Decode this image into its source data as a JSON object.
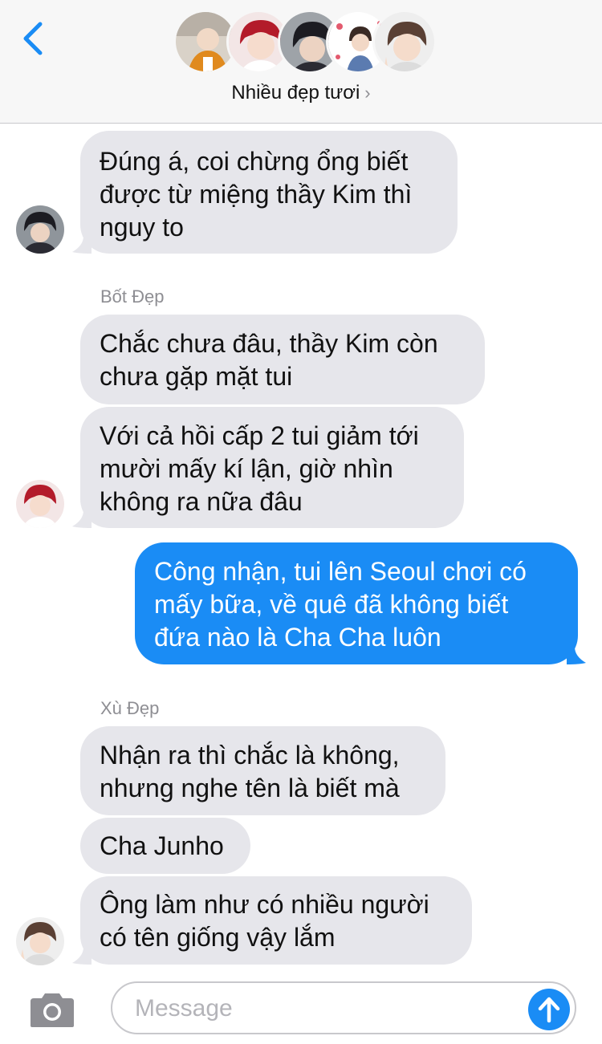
{
  "header": {
    "group_name": "Nhiều đẹp tươi",
    "chevron": "›"
  },
  "icons": {
    "back": "chevron-left-icon",
    "camera": "camera-icon",
    "send": "arrow-up-icon"
  },
  "colors": {
    "accent": "#1a8cf5",
    "incoming_bubble": "#e6e6eb",
    "header_bg": "#f7f7f7"
  },
  "messages": [
    {
      "text": "Đúng á, coi chừng ổng biết\nđược từ miệng thầy Kim thì\nnguy to",
      "direction": "incoming"
    },
    {
      "sender": "Bốt Đẹp"
    },
    {
      "text": "Chắc chưa đâu, thầy Kim còn\nchưa gặp mặt tui",
      "direction": "incoming"
    },
    {
      "text": "Với cả hồi cấp 2 tui giảm tới\nmười mấy kí lận, giờ nhìn\nkhông ra nữa đâu",
      "direction": "incoming"
    },
    {
      "text": "Công nhận, tui lên Seoul chơi có\nmấy bữa, về quê đã không biết\nđứa nào là Cha Cha luôn",
      "direction": "outgoing"
    },
    {
      "sender": "Xù Đẹp"
    },
    {
      "text": "Nhận ra thì chắc là không,\nnhưng nghe tên là biết mà",
      "direction": "incoming"
    },
    {
      "text": "Cha Junho",
      "direction": "incoming"
    },
    {
      "text": "Ông làm như có nhiều người\ncó tên giống vậy lắm",
      "direction": "incoming"
    }
  ],
  "input": {
    "placeholder": "Message",
    "value": ""
  }
}
